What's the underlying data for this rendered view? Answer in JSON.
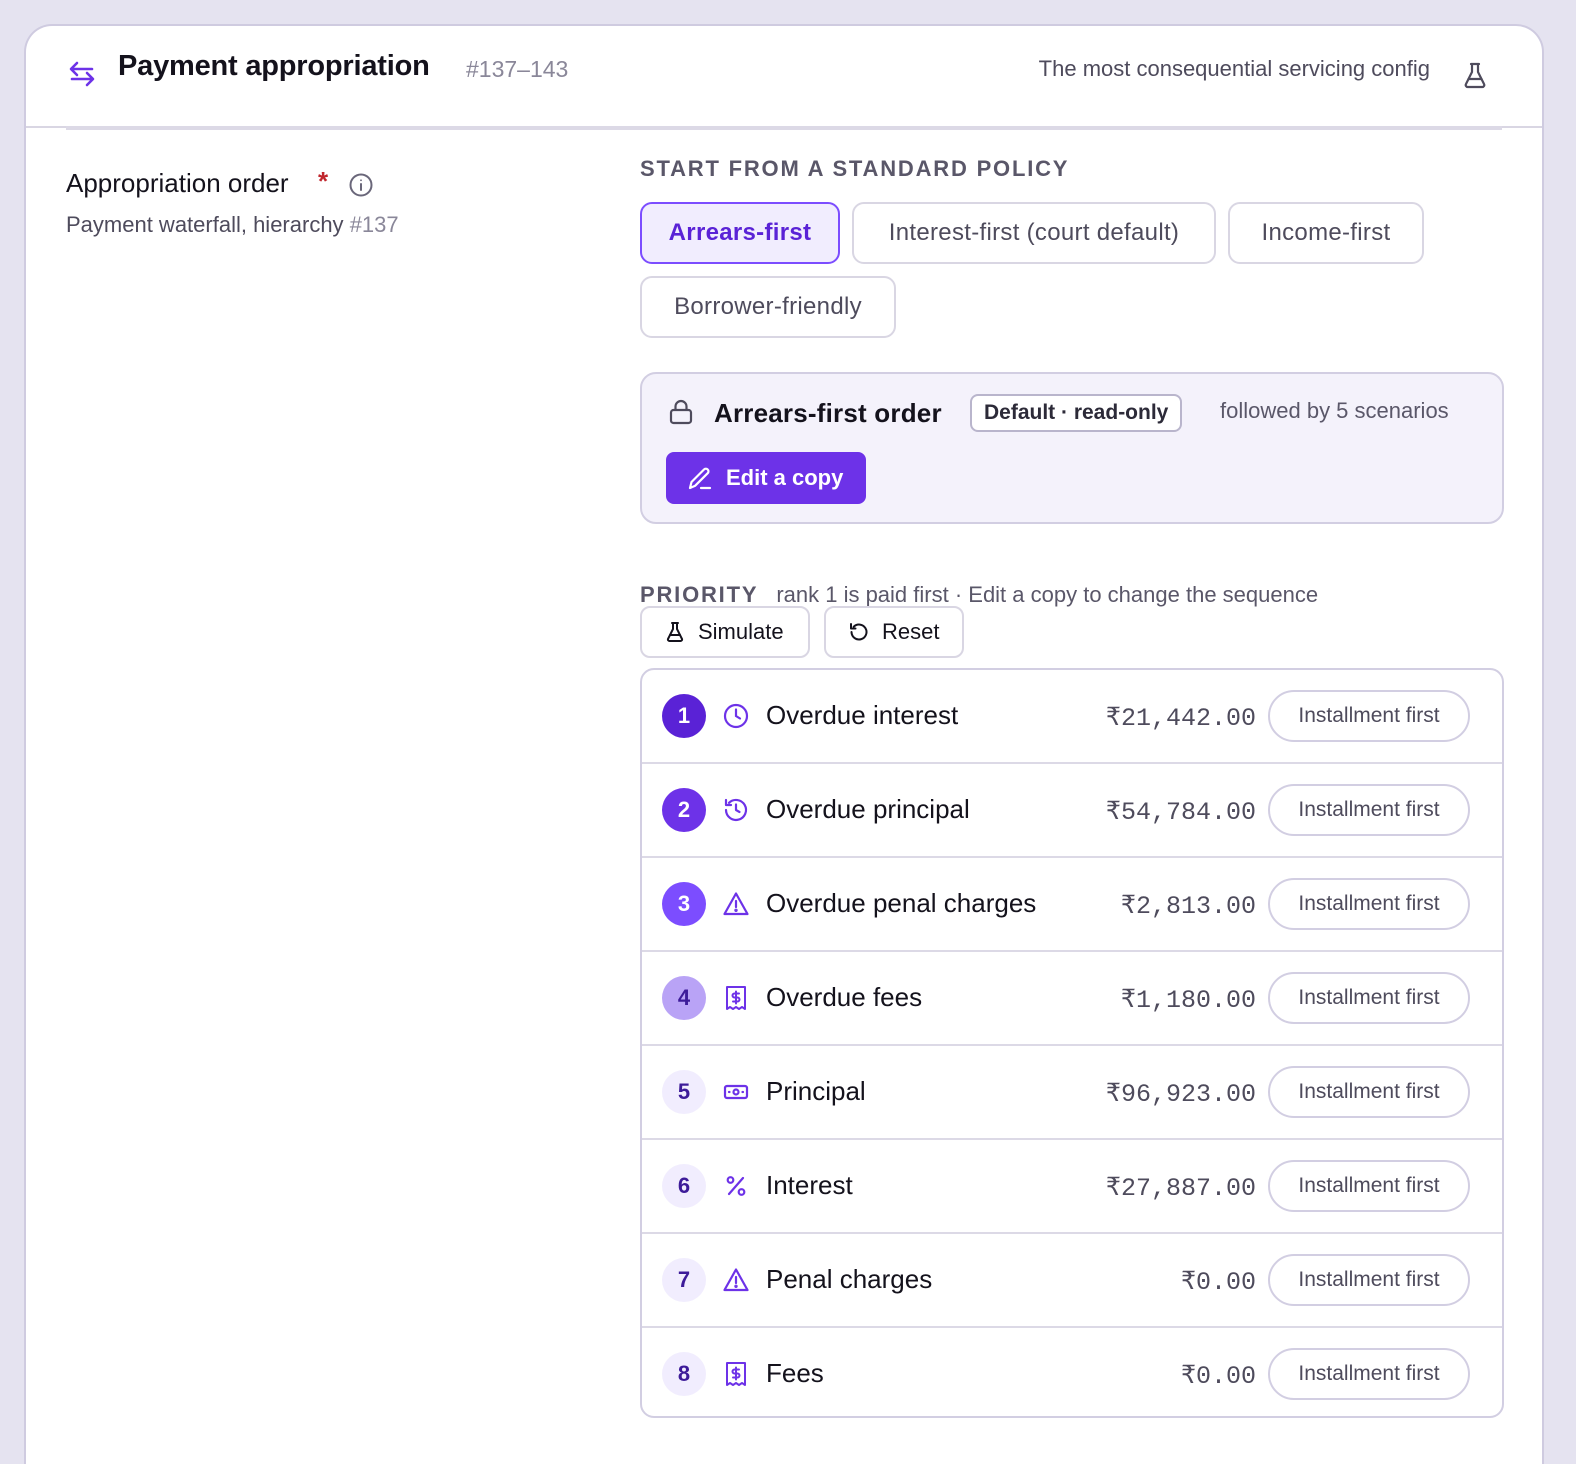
{
  "header": {
    "title": "Payment appropriation",
    "range": "#137–143",
    "note": "The most consequential servicing config"
  },
  "field": {
    "label": "Appropriation order",
    "required_mark": "*",
    "sub": "Payment waterfall, hierarchy",
    "sub_ref": "#137"
  },
  "policies": {
    "heading": "START FROM A STANDARD POLICY",
    "options": [
      "Arrears-first",
      "Interest-first (court default)",
      "Income-first",
      "Borrower-friendly"
    ],
    "selected": "Arrears-first"
  },
  "policy_box": {
    "title": "Arrears-first order",
    "badge": "Default · read-only",
    "followed": "followed by 5 scenarios",
    "edit_label": "Edit a copy"
  },
  "priority": {
    "heading": "PRIORITY",
    "hint": "rank 1 is paid first · Edit a copy to change the sequence",
    "simulate_label": "Simulate",
    "reset_label": "Reset"
  },
  "rows": [
    {
      "rank": "1",
      "icon": "clock-icon",
      "name": "Overdue interest",
      "amount": "₹21,442.00",
      "pill": "Installment first"
    },
    {
      "rank": "2",
      "icon": "history-icon",
      "name": "Overdue principal",
      "amount": "₹54,784.00",
      "pill": "Installment first"
    },
    {
      "rank": "3",
      "icon": "warning-icon",
      "name": "Overdue penal charges",
      "amount": "₹2,813.00",
      "pill": "Installment first"
    },
    {
      "rank": "4",
      "icon": "receipt-icon",
      "name": "Overdue fees",
      "amount": "₹1,180.00",
      "pill": "Installment first"
    },
    {
      "rank": "5",
      "icon": "banknote-icon",
      "name": "Principal",
      "amount": "₹96,923.00",
      "pill": "Installment first"
    },
    {
      "rank": "6",
      "icon": "percent-icon",
      "name": "Interest",
      "amount": "₹27,887.00",
      "pill": "Installment first"
    },
    {
      "rank": "7",
      "icon": "warning-icon",
      "name": "Penal charges",
      "amount": "₹0.00",
      "pill": "Installment first"
    },
    {
      "rank": "8",
      "icon": "receipt-icon",
      "name": "Fees",
      "amount": "₹0.00",
      "pill": "Installment first"
    }
  ],
  "colors": {
    "accent": "#6d32e8",
    "rank_fills": [
      "#5a22d6",
      "#6d32e8",
      "#7c4dff",
      "#b9a3f6",
      "#f1edfe",
      "#f1edfe",
      "#f1edfe",
      "#f1edfe"
    ],
    "rank_text": [
      "#ffffff",
      "#ffffff",
      "#ffffff",
      "#3d1b99",
      "#3d1b99",
      "#3d1b99",
      "#3d1b99",
      "#3d1b99"
    ]
  }
}
